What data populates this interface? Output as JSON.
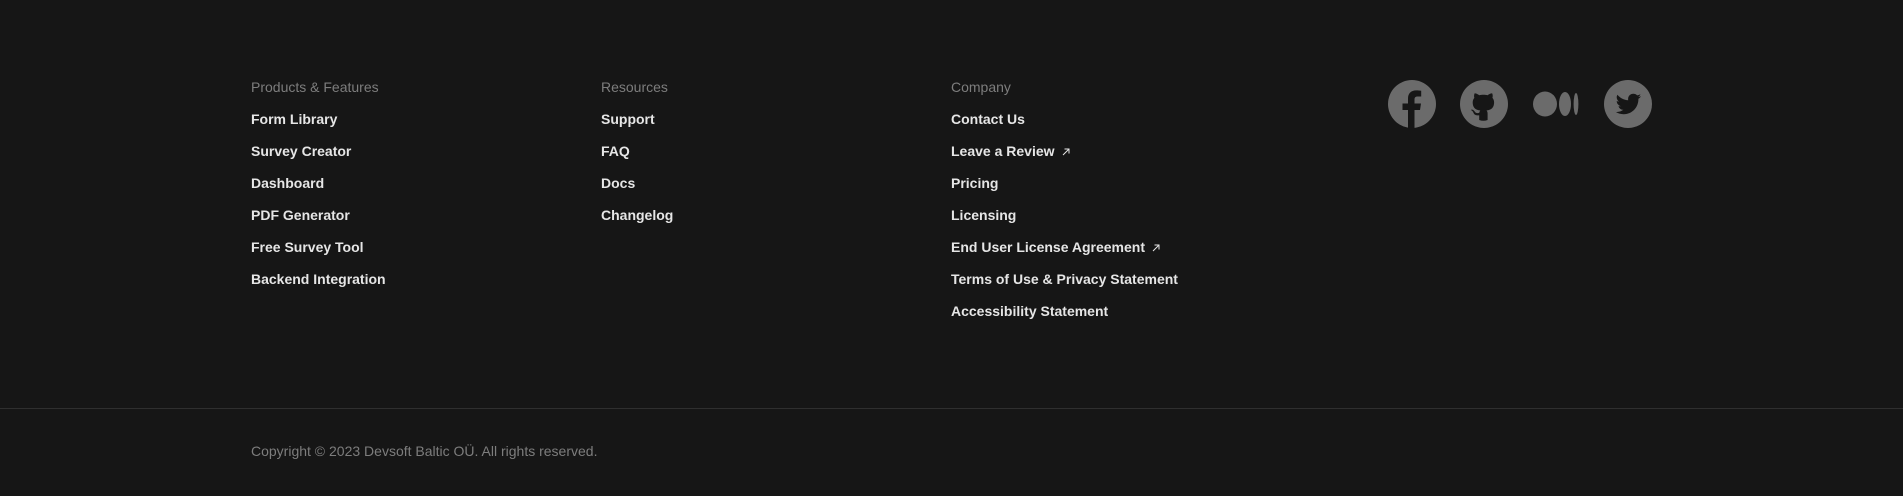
{
  "footer": {
    "products": {
      "heading": "Products & Features",
      "links": [
        {
          "label": "Form Library"
        },
        {
          "label": "Survey Creator"
        },
        {
          "label": "Dashboard"
        },
        {
          "label": "PDF Generator"
        },
        {
          "label": "Free Survey Tool"
        },
        {
          "label": "Backend Integration"
        }
      ]
    },
    "resources": {
      "heading": "Resources",
      "links": [
        {
          "label": "Support"
        },
        {
          "label": "FAQ"
        },
        {
          "label": "Docs"
        },
        {
          "label": "Changelog"
        }
      ]
    },
    "company": {
      "heading": "Company",
      "links": [
        {
          "label": "Contact Us",
          "external": false
        },
        {
          "label": "Leave a Review",
          "external": true,
          "icon": "external-link-icon"
        },
        {
          "label": "Pricing",
          "external": false
        },
        {
          "label": "Licensing",
          "external": false
        },
        {
          "label": "End User License Agreement",
          "external": true,
          "icon": "external-link-icon"
        },
        {
          "label": "Terms of Use & Privacy Statement",
          "external": false
        },
        {
          "label": "Accessibility Statement",
          "external": false
        }
      ]
    },
    "social": [
      {
        "icon": "facebook-icon"
      },
      {
        "icon": "github-icon"
      },
      {
        "icon": "medium-icon"
      },
      {
        "icon": "twitter-icon"
      }
    ],
    "copyright": "Copyright © 2023 Devsoft Baltic OÜ. All rights reserved."
  },
  "colors": {
    "background": "#161616",
    "heading": "#7d7d7d",
    "link": "#e6e6e6",
    "icon": "#6b6b6b",
    "divider": "#2f2f2f"
  }
}
